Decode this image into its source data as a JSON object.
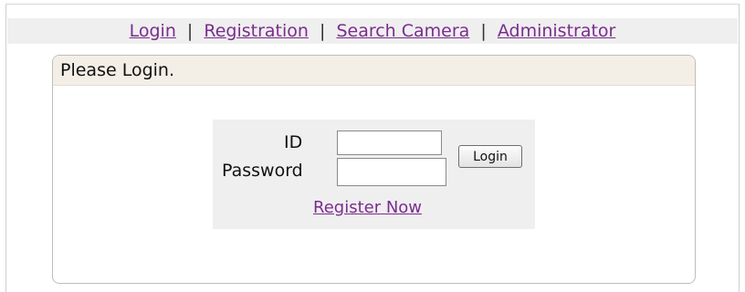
{
  "nav": {
    "links": [
      "Login",
      "Registration",
      "Search Camera",
      "Administrator"
    ],
    "separator": "|"
  },
  "panel": {
    "title": "Please Login."
  },
  "login_form": {
    "id_label": "ID",
    "password_label": "Password",
    "id_value": "",
    "password_value": "",
    "login_button": "Login",
    "register_link": "Register Now"
  },
  "colors": {
    "link": "#7b2d8e",
    "header_bg": "#f4efe6",
    "nav_bg": "#efefef",
    "form_bg": "#efefef"
  }
}
